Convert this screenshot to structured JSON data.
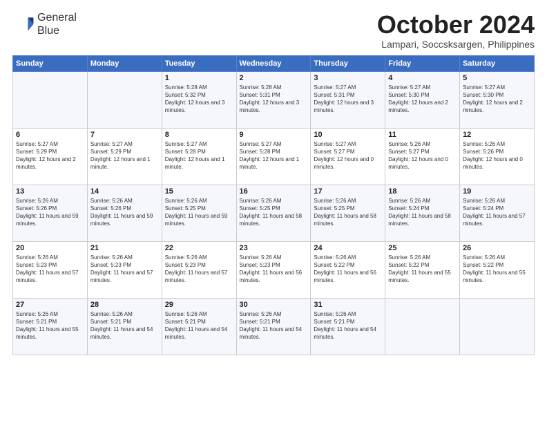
{
  "logo": {
    "line1": "General",
    "line2": "Blue"
  },
  "title": "October 2024",
  "subtitle": "Lampari, Soccsksargen, Philippines",
  "headers": [
    "Sunday",
    "Monday",
    "Tuesday",
    "Wednesday",
    "Thursday",
    "Friday",
    "Saturday"
  ],
  "weeks": [
    [
      {
        "day": "",
        "info": ""
      },
      {
        "day": "",
        "info": ""
      },
      {
        "day": "1",
        "info": "Sunrise: 5:28 AM\nSunset: 5:32 PM\nDaylight: 12 hours and 3 minutes."
      },
      {
        "day": "2",
        "info": "Sunrise: 5:28 AM\nSunset: 5:31 PM\nDaylight: 12 hours and 3 minutes."
      },
      {
        "day": "3",
        "info": "Sunrise: 5:27 AM\nSunset: 5:31 PM\nDaylight: 12 hours and 3 minutes."
      },
      {
        "day": "4",
        "info": "Sunrise: 5:27 AM\nSunset: 5:30 PM\nDaylight: 12 hours and 2 minutes."
      },
      {
        "day": "5",
        "info": "Sunrise: 5:27 AM\nSunset: 5:30 PM\nDaylight: 12 hours and 2 minutes."
      }
    ],
    [
      {
        "day": "6",
        "info": "Sunrise: 5:27 AM\nSunset: 5:29 PM\nDaylight: 12 hours and 2 minutes."
      },
      {
        "day": "7",
        "info": "Sunrise: 5:27 AM\nSunset: 5:29 PM\nDaylight: 12 hours and 1 minute."
      },
      {
        "day": "8",
        "info": "Sunrise: 5:27 AM\nSunset: 5:28 PM\nDaylight: 12 hours and 1 minute."
      },
      {
        "day": "9",
        "info": "Sunrise: 5:27 AM\nSunset: 5:28 PM\nDaylight: 12 hours and 1 minute."
      },
      {
        "day": "10",
        "info": "Sunrise: 5:27 AM\nSunset: 5:27 PM\nDaylight: 12 hours and 0 minutes."
      },
      {
        "day": "11",
        "info": "Sunrise: 5:26 AM\nSunset: 5:27 PM\nDaylight: 12 hours and 0 minutes."
      },
      {
        "day": "12",
        "info": "Sunrise: 5:26 AM\nSunset: 5:26 PM\nDaylight: 12 hours and 0 minutes."
      }
    ],
    [
      {
        "day": "13",
        "info": "Sunrise: 5:26 AM\nSunset: 5:26 PM\nDaylight: 11 hours and 59 minutes."
      },
      {
        "day": "14",
        "info": "Sunrise: 5:26 AM\nSunset: 5:26 PM\nDaylight: 11 hours and 59 minutes."
      },
      {
        "day": "15",
        "info": "Sunrise: 5:26 AM\nSunset: 5:25 PM\nDaylight: 11 hours and 59 minutes."
      },
      {
        "day": "16",
        "info": "Sunrise: 5:26 AM\nSunset: 5:25 PM\nDaylight: 11 hours and 58 minutes."
      },
      {
        "day": "17",
        "info": "Sunrise: 5:26 AM\nSunset: 5:25 PM\nDaylight: 11 hours and 58 minutes."
      },
      {
        "day": "18",
        "info": "Sunrise: 5:26 AM\nSunset: 5:24 PM\nDaylight: 11 hours and 58 minutes."
      },
      {
        "day": "19",
        "info": "Sunrise: 5:26 AM\nSunset: 5:24 PM\nDaylight: 11 hours and 57 minutes."
      }
    ],
    [
      {
        "day": "20",
        "info": "Sunrise: 5:26 AM\nSunset: 5:23 PM\nDaylight: 11 hours and 57 minutes."
      },
      {
        "day": "21",
        "info": "Sunrise: 5:26 AM\nSunset: 5:23 PM\nDaylight: 11 hours and 57 minutes."
      },
      {
        "day": "22",
        "info": "Sunrise: 5:26 AM\nSunset: 5:23 PM\nDaylight: 11 hours and 57 minutes."
      },
      {
        "day": "23",
        "info": "Sunrise: 5:26 AM\nSunset: 5:23 PM\nDaylight: 11 hours and 56 minutes."
      },
      {
        "day": "24",
        "info": "Sunrise: 5:26 AM\nSunset: 5:22 PM\nDaylight: 11 hours and 56 minutes."
      },
      {
        "day": "25",
        "info": "Sunrise: 5:26 AM\nSunset: 5:22 PM\nDaylight: 11 hours and 55 minutes."
      },
      {
        "day": "26",
        "info": "Sunrise: 5:26 AM\nSunset: 5:22 PM\nDaylight: 11 hours and 55 minutes."
      }
    ],
    [
      {
        "day": "27",
        "info": "Sunrise: 5:26 AM\nSunset: 5:21 PM\nDaylight: 11 hours and 55 minutes."
      },
      {
        "day": "28",
        "info": "Sunrise: 5:26 AM\nSunset: 5:21 PM\nDaylight: 11 hours and 54 minutes."
      },
      {
        "day": "29",
        "info": "Sunrise: 5:26 AM\nSunset: 5:21 PM\nDaylight: 11 hours and 54 minutes."
      },
      {
        "day": "30",
        "info": "Sunrise: 5:26 AM\nSunset: 5:21 PM\nDaylight: 11 hours and 54 minutes."
      },
      {
        "day": "31",
        "info": "Sunrise: 5:26 AM\nSunset: 5:21 PM\nDaylight: 11 hours and 54 minutes."
      },
      {
        "day": "",
        "info": ""
      },
      {
        "day": "",
        "info": ""
      }
    ]
  ]
}
